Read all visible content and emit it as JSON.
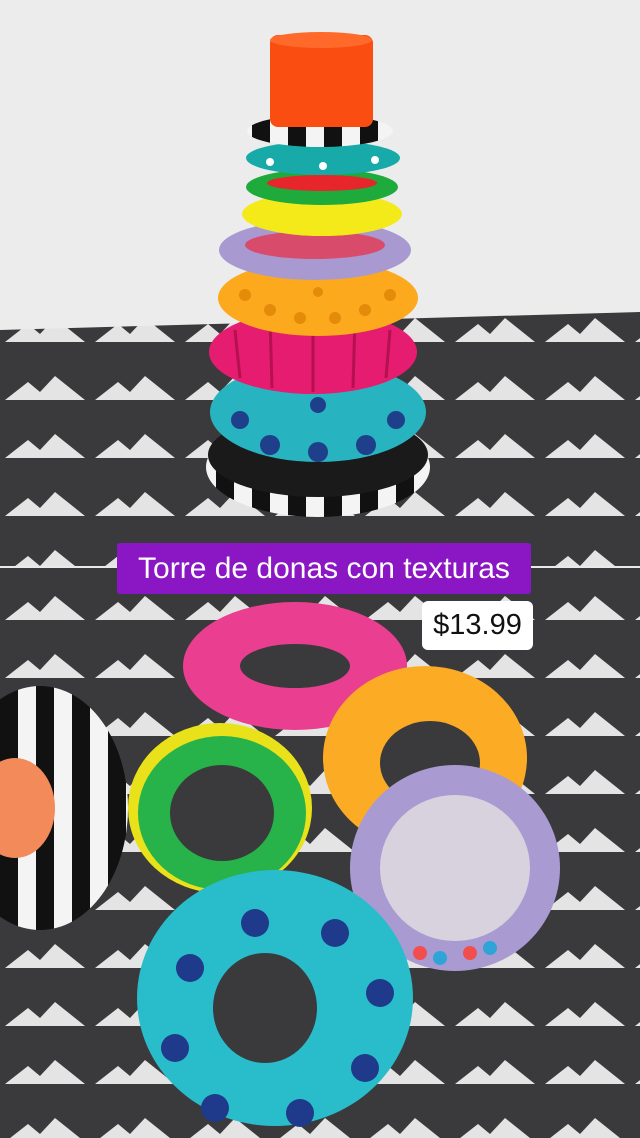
{
  "overlay": {
    "title": "Torre de donas con texturas",
    "price": "$13.99"
  },
  "colors": {
    "title_bg": "#8b16c4",
    "price_bg": "#ffffff",
    "fabric": "#3a3a3c",
    "wall": "#ececec"
  }
}
